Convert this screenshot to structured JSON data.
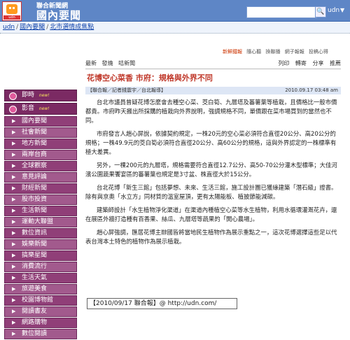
{
  "header": {
    "site_small": "聯合新聞網",
    "site_big": "國內要聞",
    "logo_tag": "udn",
    "search_placeholder": "",
    "search_scope": "udn",
    "search_btn": "🔍"
  },
  "breadcrumb": {
    "items": [
      "udn",
      "國內要聞",
      "北市選情成焦點"
    ]
  },
  "toplinks": {
    "items": [
      "新鮮鐵報",
      "隨心聽",
      "換聯播",
      "網子報報",
      "投稿心得"
    ]
  },
  "toolbar": {
    "tabs": [
      "最新",
      "發燒",
      "咭新聞"
    ],
    "tools": [
      "列印",
      "轉寄",
      "分享",
      "推薦"
    ]
  },
  "article": {
    "title": "花博空心菜香 市府：規格與外界不同",
    "source": "【聯合報／記者錢震宇／台北報導】",
    "date": "2010.09.17 03:48 am",
    "paragraphs": [
      "台北市議員曾疑花博怎麼會去種空心菜、茭白筍、九層塔及蕃薯葉等植栽，且價格比一般市價都貴。市府昨天搬出所採購的植栽向外界說明，強調規格不同，單價跟在菜市場買到的當然也不同。",
      "市府發言人趙心屏說，依據契約規定，一株20元的空心菜必須符合直徑20公分、高20公分的規格；一株49.9元的茭白筍必須符合直徑20公分、高60公分的規格，這與外界認定的一株標準有極大差異。",
      "另外，一棵200元的九層塔，規格需要符合直徑12.7公分、高50-70公分灌木型標準；大佳河濱公園蔬果饗宴區的蕃薯葉也規定是3寸盆、株直徑大於15公分。",
      "台北花博「新生三館」包括夢想、未來、生活三館，施工設計團已獲綠建築「潛石級」證書。除有與京奧「水立方」同材質的溫室屋頂，更有太陽能板、植披節能減碳。",
      "建築師設計「水生植物淨化渠道」在渠道內種植空心菜等水生植物，利用水循環灌溉花卉，還在展區外牆打造種有百香果、絲瓜、九層塔等蔬果的「開心農場」。",
      "趙心屏強調，匯居花博主辦國皆將當地民生植物作為展示重點之一，這次花博選擇這些足以代表台灣本土特色的植物作為展示植栽。"
    ],
    "signature": "【2010/09/17 聯合報】@ http://udn.com/"
  },
  "sidebar": {
    "items": [
      {
        "label": "即時",
        "new": "new!"
      },
      {
        "label": "影音",
        "new": "new!"
      }
    ],
    "subitems": [
      "國內要聞",
      "社會新聞",
      "地方新聞",
      "兩岸台商",
      "全球觀察",
      "意見評論",
      "財經新聞",
      "股市投資",
      "生活新聞",
      "運動大聯盟",
      "數位資訊",
      "娛樂新聞",
      "搞樂星聞",
      "消費流行",
      "生活天氣",
      "旅遊美食",
      "校園博物館",
      "閱讀書友",
      "網路購物",
      "數位閱讀"
    ]
  },
  "colors": {
    "header_bg": "#5e86c6",
    "sidebar_bg": "#7b2a63",
    "title_color": "#c0392b"
  }
}
